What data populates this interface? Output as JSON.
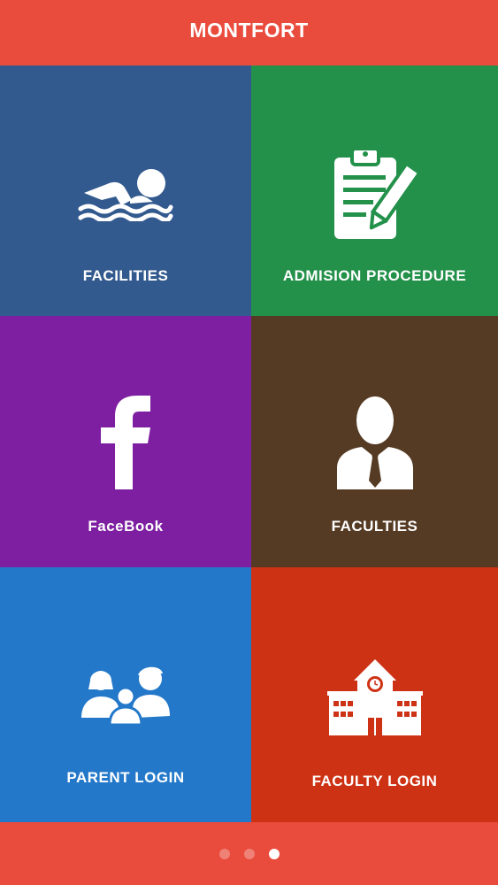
{
  "app": {
    "title": "MONTFORT"
  },
  "tiles": [
    {
      "label": "FACILITIES",
      "icon": "swimmer-icon",
      "color": "#335a8e"
    },
    {
      "label": "ADMISION PROCEDURE",
      "icon": "clipboard-pen-icon",
      "color": "#24914b"
    },
    {
      "label": "FaceBook",
      "icon": "facebook-icon",
      "color": "#7d1fa0"
    },
    {
      "label": "FACULTIES",
      "icon": "businessman-icon",
      "color": "#553b24"
    },
    {
      "label": "PARENT LOGIN",
      "icon": "family-icon",
      "color": "#2478c9"
    },
    {
      "label": "FACULTY LOGIN",
      "icon": "school-building-icon",
      "color": "#cd3214"
    }
  ],
  "pager": {
    "pages": 3,
    "active": 3
  },
  "colors": {
    "header": "#e94b3c",
    "footer": "#e94b3c"
  }
}
